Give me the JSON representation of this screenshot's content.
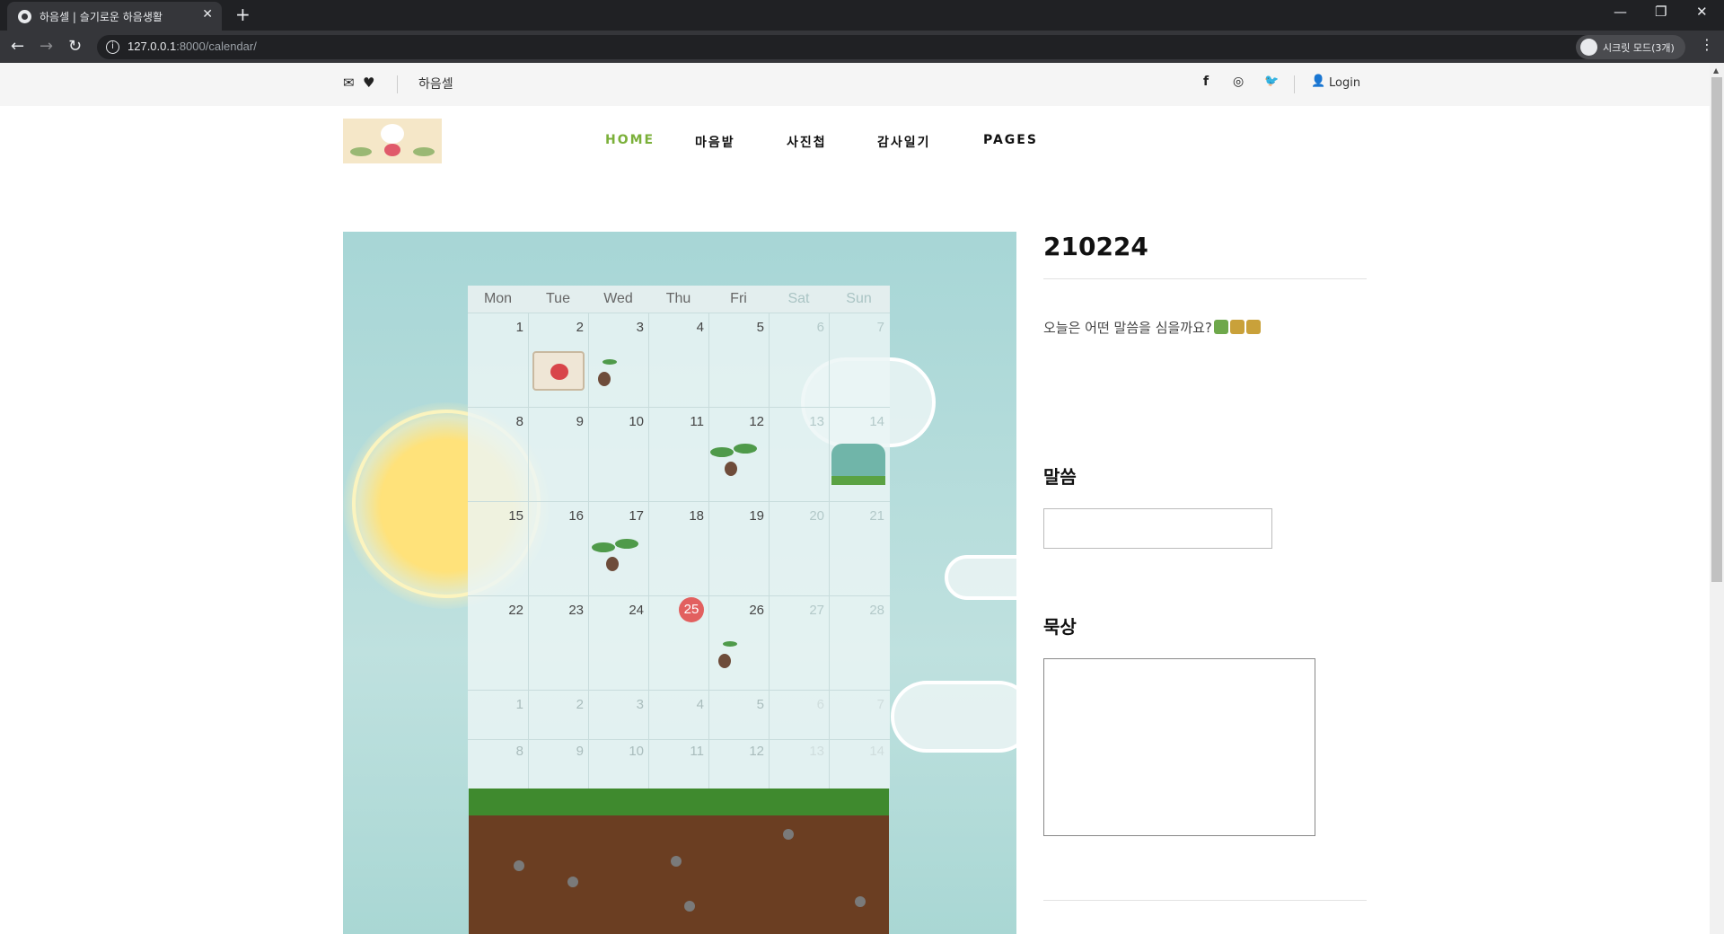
{
  "browser": {
    "tab_title": "하음셀 | 슬기로운 하음생활",
    "url_host": "127.0.0.1",
    "url_path": ":8000/calendar/",
    "profile_label": "시크릿 모드(3개)"
  },
  "topbar": {
    "site_name": "하음셀",
    "login_label": "Login"
  },
  "nav": {
    "items": [
      {
        "label": "HOME",
        "active": true
      },
      {
        "label": "마음밭"
      },
      {
        "label": "사진첩"
      },
      {
        "label": "감사일기"
      },
      {
        "label": "PAGES"
      }
    ]
  },
  "calendar": {
    "weekdays": [
      "Mon",
      "Tue",
      "Wed",
      "Thu",
      "Fri",
      "Sat",
      "Sun"
    ],
    "weeks": [
      [
        "1",
        "2",
        "3",
        "4",
        "5",
        "6",
        "7"
      ],
      [
        "8",
        "9",
        "10",
        "11",
        "12",
        "13",
        "14"
      ],
      [
        "15",
        "16",
        "17",
        "18",
        "19",
        "20",
        "21"
      ],
      [
        "22",
        "23",
        "24",
        "25",
        "26",
        "27",
        "28"
      ],
      [
        "1",
        "2",
        "3",
        "4",
        "5",
        "6",
        "7"
      ],
      [
        "8",
        "9",
        "10",
        "11",
        "12",
        "13",
        "14"
      ]
    ],
    "today": "25"
  },
  "entry": {
    "date_title": "210224",
    "prompt": "오늘은 어떤 말씀을 심을까요?",
    "word_label": "말씀",
    "meditation_label": "묵상"
  },
  "icons": {
    "mail": "envelope-icon",
    "heart": "heart-icon",
    "facebook": "facebook-icon",
    "instagram": "instagram-icon",
    "twitter": "twitter-icon",
    "user": "user-icon"
  },
  "colors": {
    "nav_active": "#7bb03a",
    "today_marker": "#e2605f"
  }
}
